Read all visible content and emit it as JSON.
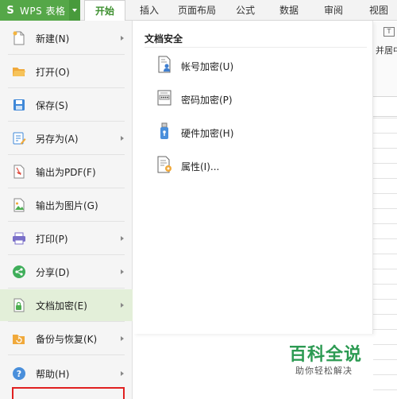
{
  "app": {
    "title": "WPS 表格",
    "logo_letter": "S"
  },
  "ribbon": {
    "tabs": [
      {
        "label": "开始"
      },
      {
        "label": "插入"
      },
      {
        "label": "页面布局"
      },
      {
        "label": "公式"
      },
      {
        "label": "数据"
      },
      {
        "label": "审阅"
      },
      {
        "label": "视图"
      }
    ],
    "active_tab": "开始",
    "partial_label": "并居中",
    "merge_icon_text": "T"
  },
  "menu": {
    "items": [
      {
        "label": "新建(N)",
        "icon": "new-document-icon",
        "has_submenu": true
      },
      {
        "label": "打开(O)",
        "icon": "folder-open-icon",
        "has_submenu": false
      },
      {
        "label": "保存(S)",
        "icon": "save-icon",
        "has_submenu": false
      },
      {
        "label": "另存为(A)",
        "icon": "save-as-icon",
        "has_submenu": true
      },
      {
        "label": "输出为PDF(F)",
        "icon": "pdf-export-icon",
        "has_submenu": false
      },
      {
        "label": "输出为图片(G)",
        "icon": "image-export-icon",
        "has_submenu": false
      },
      {
        "label": "打印(P)",
        "icon": "printer-icon",
        "has_submenu": true
      },
      {
        "label": "分享(D)",
        "icon": "share-icon",
        "has_submenu": true
      },
      {
        "label": "文档加密(E)",
        "icon": "document-encrypt-icon",
        "has_submenu": true
      },
      {
        "label": "备份与恢复(K)",
        "icon": "backup-restore-icon",
        "has_submenu": true
      },
      {
        "label": "帮助(H)",
        "icon": "help-icon",
        "has_submenu": true
      }
    ],
    "selected": "文档加密(E)"
  },
  "submenu": {
    "title": "文档安全",
    "items": [
      {
        "label": "帐号加密(U)",
        "icon": "account-encrypt-icon"
      },
      {
        "label": "密码加密(P)",
        "icon": "password-encrypt-icon"
      },
      {
        "label": "硬件加密(H)",
        "icon": "hardware-encrypt-icon"
      },
      {
        "label": "属性(I)...",
        "icon": "properties-icon"
      }
    ]
  },
  "watermark": {
    "title": "百科全说",
    "subtitle": "助你轻松解决"
  },
  "colors": {
    "accent_green": "#55a748",
    "selected_bg": "#e3efd9",
    "highlight_red": "#e02020"
  }
}
